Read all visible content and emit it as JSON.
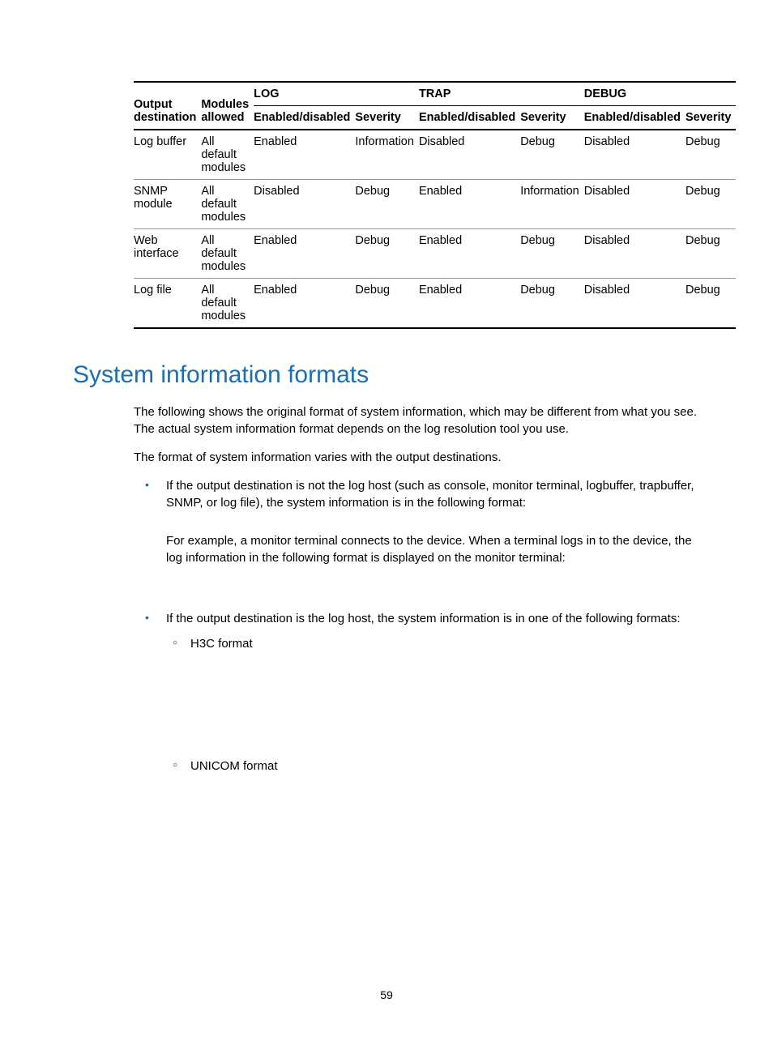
{
  "table": {
    "head": {
      "col1": "Output destination",
      "col2": "Modules allowed",
      "group_log": "LOG",
      "group_trap": "TRAP",
      "group_debug": "DEBUG",
      "sub_enabled1": "Enabled/disabled",
      "sub_sev1": "Severity",
      "sub_enabled2": "Enabled/disabled",
      "sub_sev2": "Severity",
      "sub_enabled3": "Enabled/disabled",
      "sub_sev3": "Severity"
    },
    "rows": [
      {
        "dest": "Log buffer",
        "mods": "All default modules",
        "log_en": "Enabled",
        "log_sev": "Information",
        "trap_en": "Disabled",
        "trap_sev": "Debug",
        "dbg_en": "Disabled",
        "dbg_sev": "Debug"
      },
      {
        "dest": "SNMP module",
        "mods": "All default modules",
        "log_en": "Disabled",
        "log_sev": "Debug",
        "trap_en": "Enabled",
        "trap_sev": "Information",
        "dbg_en": "Disabled",
        "dbg_sev": "Debug"
      },
      {
        "dest": "Web interface",
        "mods": "All default modules",
        "log_en": "Enabled",
        "log_sev": "Debug",
        "trap_en": "Enabled",
        "trap_sev": "Debug",
        "dbg_en": "Disabled",
        "dbg_sev": "Debug"
      },
      {
        "dest": "Log file",
        "mods": "All default modules",
        "log_en": "Enabled",
        "log_sev": "Debug",
        "trap_en": "Enabled",
        "trap_sev": "Debug",
        "dbg_en": "Disabled",
        "dbg_sev": "Debug"
      }
    ]
  },
  "section_heading": "System information formats",
  "para1": "The following shows the original format of system information, which may be different from what you see. The actual system information format depends on the log resolution tool you use.",
  "para2": "The format of system information varies with the output destinations.",
  "bullet1_a": "If the output destination is not the log host (such as console, monitor terminal, logbuffer, trapbuffer, SNMP, or log file), the system information is in the following format:",
  "bullet1_b": "For example, a monitor terminal connects to the device. When a terminal logs in to the device, the log information in the following format is displayed on the monitor terminal:",
  "bullet2": "If the output destination is the log host, the system information is in one of the following formats:",
  "sub1": "H3C format",
  "sub2": "UNICOM format",
  "page_number": "59"
}
